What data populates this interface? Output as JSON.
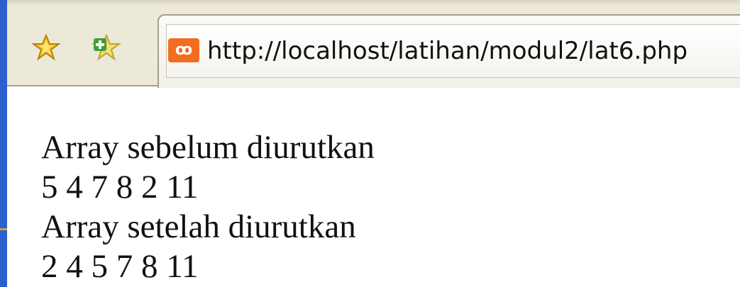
{
  "browser": {
    "bookmark_icon": "star-icon",
    "add_bookmark_icon": "star-add-icon",
    "favicon_icon": "xampp-favicon-icon",
    "url": "http://localhost/latihan/modul2/lat6.php"
  },
  "page": {
    "lines": [
      "Array sebelum diurutkan",
      "5 4 7 8 2 11",
      "Array setelah diurutkan",
      "2 4 5 7 8 11"
    ]
  },
  "colors": {
    "favicon": "#f26d1f",
    "window_edge": "#2c5fcf",
    "toolbar": "#ece9d8"
  }
}
